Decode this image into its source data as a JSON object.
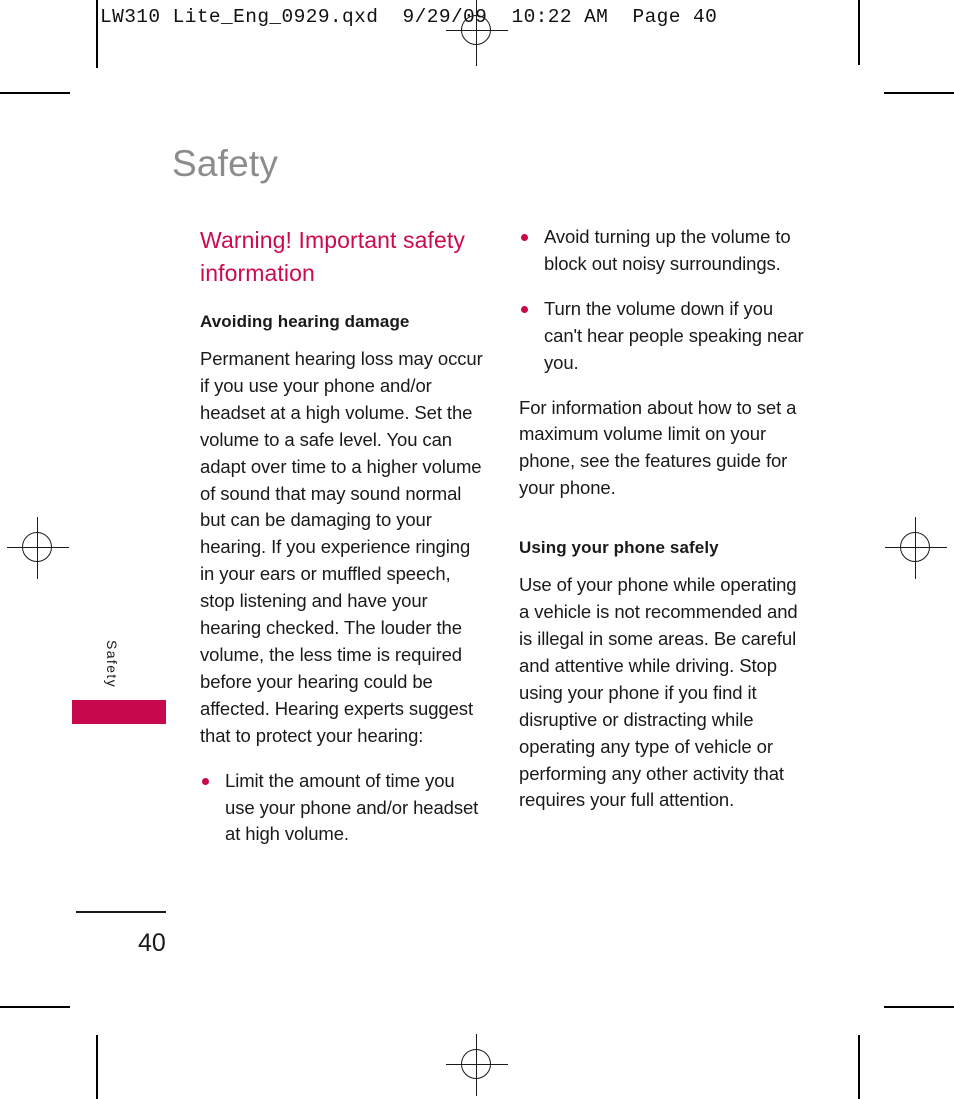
{
  "print_header": {
    "text": "LW310 Lite_Eng_0929.qxd  9/29/09  10:22 AM  Page 40"
  },
  "page": {
    "title": "Safety",
    "side_tab_label": "Safety",
    "page_number": "40"
  },
  "colors": {
    "accent": "#c8084c",
    "heading": "#cc0a50",
    "title_gray": "#8c8c8c",
    "body": "#1a1a1a"
  },
  "left_column": {
    "warning_heading": "Warning! Important safety information",
    "sub_heading": "Avoiding hearing damage",
    "paragraph": "Permanent hearing loss may occur if you use your phone and/or headset at a high volume. Set the volume to a safe level. You can adapt over time to a higher volume of sound that may sound normal but can be damaging to your hearing. If you experience ringing in your ears or muffled speech, stop listening and have your hearing checked. The louder the volume, the less time is required before your hearing could be affected. Hearing experts suggest that to protect your hearing:",
    "bullets": [
      "Limit the amount of time you use your phone and/or headset at high volume."
    ]
  },
  "right_column": {
    "bullets": [
      "Avoid turning up the volume to block out noisy surroundings.",
      "Turn the volume down if you can't hear people speaking near you."
    ],
    "paragraph": "For information about how to set a maximum volume limit on your phone, see the features guide for your phone.",
    "sub_heading": "Using your phone safely",
    "paragraph2": "Use of your phone while operating a vehicle is not recommended and is illegal in some areas. Be careful and attentive while driving. Stop using your phone if you find it disruptive or distracting while operating any type of vehicle or performing any other activity that requires your full attention."
  }
}
